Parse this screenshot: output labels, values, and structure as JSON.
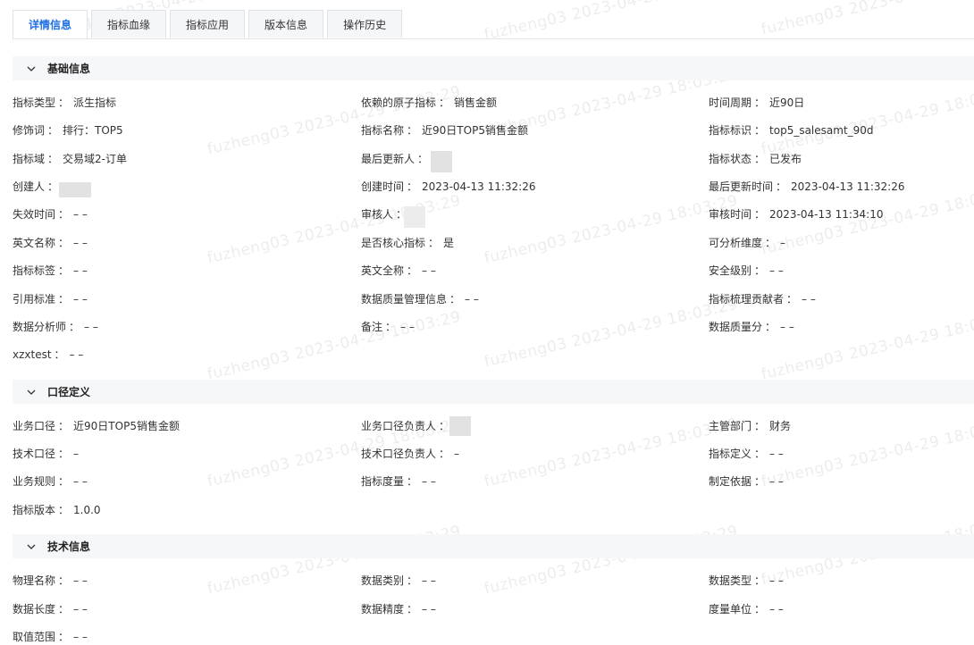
{
  "tabs": [
    {
      "label": "详情信息",
      "active": true
    },
    {
      "label": "指标血缘",
      "active": false
    },
    {
      "label": "指标应用",
      "active": false
    },
    {
      "label": "版本信息",
      "active": false
    },
    {
      "label": "操作历史",
      "active": false
    }
  ],
  "sections": {
    "basic": {
      "title": "基础信息"
    },
    "caliber": {
      "title": "口径定义"
    },
    "tech": {
      "title": "技术信息"
    }
  },
  "separator": "：",
  "basic": {
    "metric_type": {
      "label": "指标类型",
      "value": "派生指标"
    },
    "atomic_metric": {
      "label": "依赖的原子指标",
      "value": "销售金额"
    },
    "time_period": {
      "label": "时间周期",
      "value": "近90日"
    },
    "modifier": {
      "label": "修饰词",
      "value": "排行：TOP5"
    },
    "metric_name": {
      "label": "指标名称",
      "value": "近90日TOP5销售金额"
    },
    "metric_id": {
      "label": "指标标识",
      "value": "top5_salesamt_90d"
    },
    "metric_domain": {
      "label": "指标域",
      "value": "交易域2-订单"
    },
    "last_updater": {
      "label": "最后更新人",
      "value": ""
    },
    "metric_status": {
      "label": "指标状态",
      "value": "已发布"
    },
    "creator": {
      "label": "创建人",
      "value": ""
    },
    "create_time": {
      "label": "创建时间",
      "value": "2023-04-13 11:32:26"
    },
    "last_update_time": {
      "label": "最后更新时间",
      "value": "2023-04-13 11:32:26"
    },
    "expire_time": {
      "label": "失效时间",
      "value": "– –"
    },
    "reviewer": {
      "label": "审核人",
      "value": ""
    },
    "review_time": {
      "label": "审核时间",
      "value": "2023-04-13 11:34:10"
    },
    "english_name": {
      "label": "英文名称",
      "value": "– –"
    },
    "is_core": {
      "label": "是否核心指标",
      "value": "是"
    },
    "analyzable_dim": {
      "label": "可分析维度",
      "value": "–"
    },
    "metric_tags": {
      "label": "指标标签",
      "value": "– –"
    },
    "english_fullname": {
      "label": "英文全称",
      "value": "– –"
    },
    "security_level": {
      "label": "安全级别",
      "value": "– –"
    },
    "ref_standard": {
      "label": "引用标准",
      "value": "– –"
    },
    "dq_mgmt_info": {
      "label": "数据质量管理信息",
      "value": "– –"
    },
    "contributor": {
      "label": "指标梳理贡献者",
      "value": "– –"
    },
    "analyst": {
      "label": "数据分析师",
      "value": "– –"
    },
    "remark": {
      "label": "备注",
      "value": "– –"
    },
    "dq_score": {
      "label": "数据质量分",
      "value": "– –"
    },
    "xzxtest": {
      "label": "xzxtest",
      "value": "– –"
    }
  },
  "caliber": {
    "biz_caliber": {
      "label": "业务口径",
      "value": "近90日TOP5销售金额"
    },
    "biz_owner": {
      "label": "业务口径负责人",
      "value": ""
    },
    "dept": {
      "label": "主管部门",
      "value": "财务"
    },
    "tech_caliber": {
      "label": "技术口径",
      "value": "–"
    },
    "tech_owner": {
      "label": "技术口径负责人",
      "value": "–"
    },
    "metric_def": {
      "label": "指标定义",
      "value": "– –"
    },
    "biz_rule": {
      "label": "业务规则",
      "value": "– –"
    },
    "metric_measure": {
      "label": "指标度量",
      "value": "– –"
    },
    "basis": {
      "label": "制定依据",
      "value": "– –"
    },
    "version": {
      "label": "指标版本",
      "value": "1.0.0"
    }
  },
  "tech": {
    "physical_name": {
      "label": "物理名称",
      "value": "– –"
    },
    "data_category": {
      "label": "数据类别",
      "value": "– –"
    },
    "data_type": {
      "label": "数据类型",
      "value": "– –"
    },
    "data_length": {
      "label": "数据长度",
      "value": "– –"
    },
    "data_precision": {
      "label": "数据精度",
      "value": "– –"
    },
    "unit": {
      "label": "度量单位",
      "value": "– –"
    },
    "value_range": {
      "label": "取值范围",
      "value": "– –"
    }
  },
  "watermark": {
    "user": "fuzheng03",
    "times": [
      "2023-04-29 18:03:29",
      "2023-04-29 16:03:29"
    ]
  },
  "icons": {
    "chevron": "chevron-down-icon"
  },
  "colors": {
    "accent": "#1f6fe5",
    "header_bg": "#f6f7f9",
    "tab_bg": "#f5f6f8"
  }
}
